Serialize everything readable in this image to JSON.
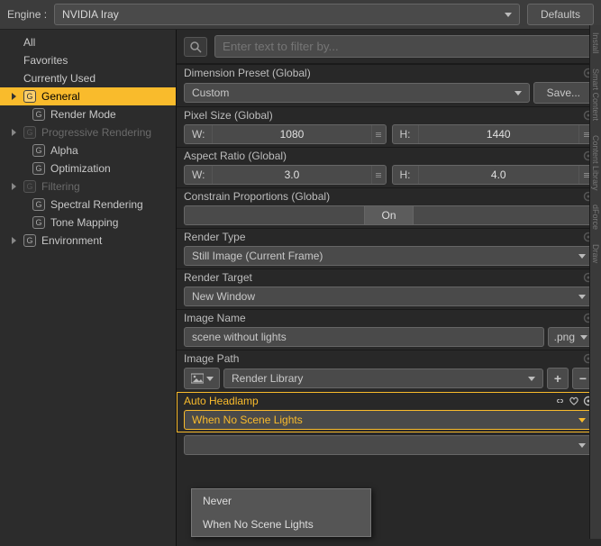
{
  "topbar": {
    "engine_label": "Engine :",
    "engine_value": "NVIDIA Iray",
    "defaults": "Defaults"
  },
  "sidebar": {
    "items": [
      {
        "label": "All",
        "expand": false,
        "icon": false,
        "indent": false,
        "dim": false,
        "selected": false
      },
      {
        "label": "Favorites",
        "expand": false,
        "icon": false,
        "indent": false,
        "dim": false,
        "selected": false
      },
      {
        "label": "Currently Used",
        "expand": false,
        "icon": false,
        "indent": false,
        "dim": false,
        "selected": false
      },
      {
        "label": "General",
        "expand": true,
        "icon": true,
        "indent": false,
        "dim": false,
        "selected": true
      },
      {
        "label": "Render Mode",
        "expand": false,
        "icon": true,
        "indent": true,
        "dim": false,
        "selected": false
      },
      {
        "label": "Progressive Rendering",
        "expand": true,
        "icon": true,
        "indent": false,
        "dim": true,
        "selected": false
      },
      {
        "label": "Alpha",
        "expand": false,
        "icon": true,
        "indent": true,
        "dim": false,
        "selected": false
      },
      {
        "label": "Optimization",
        "expand": false,
        "icon": true,
        "indent": true,
        "dim": false,
        "selected": false
      },
      {
        "label": "Filtering",
        "expand": true,
        "icon": true,
        "indent": false,
        "dim": true,
        "selected": false
      },
      {
        "label": "Spectral Rendering",
        "expand": false,
        "icon": true,
        "indent": true,
        "dim": false,
        "selected": false
      },
      {
        "label": "Tone Mapping",
        "expand": false,
        "icon": true,
        "indent": true,
        "dim": false,
        "selected": false
      },
      {
        "label": "Environment",
        "expand": true,
        "icon": true,
        "indent": false,
        "dim": false,
        "selected": false
      }
    ]
  },
  "search": {
    "placeholder": "Enter text to filter by..."
  },
  "props": {
    "dimension_preset": {
      "label": "Dimension Preset (Global)",
      "value": "Custom",
      "save": "Save..."
    },
    "pixel_size": {
      "label": "Pixel Size (Global)",
      "w_label": "W:",
      "w": "1080",
      "h_label": "H:",
      "h": "1440"
    },
    "aspect_ratio": {
      "label": "Aspect Ratio (Global)",
      "w_label": "W:",
      "w": "3.0",
      "h_label": "H:",
      "h": "4.0"
    },
    "constrain": {
      "label": "Constrain Proportions (Global)",
      "value": "On"
    },
    "render_type": {
      "label": "Render Type",
      "value": "Still Image (Current Frame)"
    },
    "render_target": {
      "label": "Render Target",
      "value": "New Window"
    },
    "image_name": {
      "label": "Image Name",
      "value": "scene without lights",
      "ext": ".png"
    },
    "image_path": {
      "label": "Image Path",
      "value": "Render Library"
    },
    "auto_headlamp": {
      "label": "Auto Headlamp",
      "value": "When No Scene Lights",
      "options": [
        "Never",
        "When No Scene Lights"
      ]
    }
  },
  "right_tabs": [
    "Install",
    "Smart Content",
    "Content Library",
    "dForce",
    "Draw"
  ]
}
